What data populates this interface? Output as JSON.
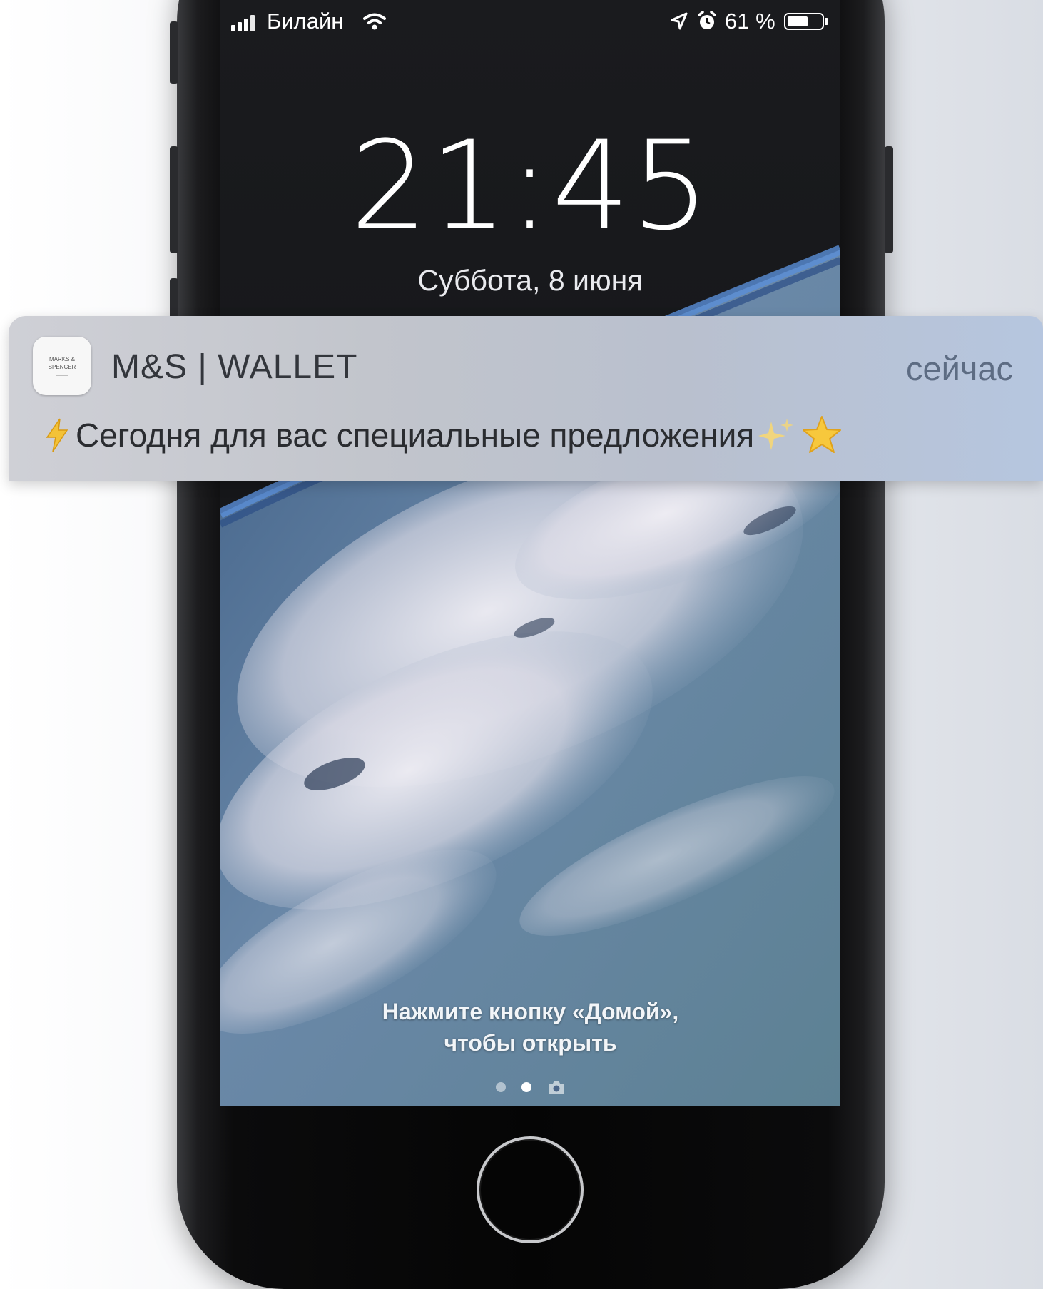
{
  "status_bar": {
    "carrier": "Билайн",
    "battery_percent": "61 %",
    "battery_level": 0.61,
    "icons": [
      "signal-icon",
      "wifi-icon",
      "location-icon",
      "alarm-icon",
      "battery-icon"
    ]
  },
  "lock_screen": {
    "time": "21:45",
    "date": "Суббота, 8 июня",
    "unlock_hint_line1": "Нажмите кнопку «Домой»,",
    "unlock_hint_line2": "чтобы открыть",
    "page_indicator": {
      "pages": 2,
      "active": 1,
      "trailing_icon": "camera-icon"
    }
  },
  "notification": {
    "app_name": "M&S | WALLET",
    "time": "сейчас",
    "icon_text": [
      "MARKS &",
      "SPENCER"
    ],
    "message": "Сегодня для вас специальные предложения",
    "leading_emoji": "lightning-icon",
    "trailing_emoji": [
      "sparkles-icon",
      "star-icon"
    ]
  },
  "colors": {
    "notification_time": "#5d6c83",
    "notification_text": "#2a2c30",
    "lock_text": "#ffffff"
  }
}
